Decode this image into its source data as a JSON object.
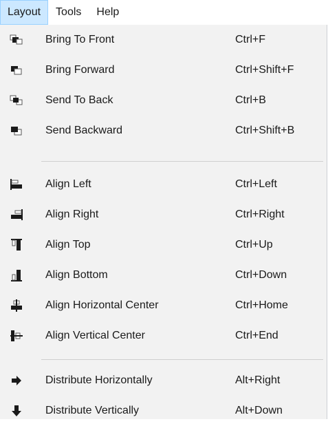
{
  "menubar": {
    "items": [
      {
        "label": "Layout"
      },
      {
        "label": "Tools"
      },
      {
        "label": "Help"
      }
    ]
  },
  "menu": {
    "groups": [
      [
        {
          "label": "Bring To Front",
          "shortcut": "Ctrl+F",
          "icon": "bring-to-front-icon"
        },
        {
          "label": "Bring Forward",
          "shortcut": "Ctrl+Shift+F",
          "icon": "bring-forward-icon"
        },
        {
          "label": "Send To Back",
          "shortcut": "Ctrl+B",
          "icon": "send-to-back-icon"
        },
        {
          "label": "Send Backward",
          "shortcut": "Ctrl+Shift+B",
          "icon": "send-backward-icon"
        }
      ],
      [
        {
          "label": "Align Left",
          "shortcut": "Ctrl+Left",
          "icon": "align-left-icon"
        },
        {
          "label": "Align Right",
          "shortcut": "Ctrl+Right",
          "icon": "align-right-icon"
        },
        {
          "label": "Align Top",
          "shortcut": "Ctrl+Up",
          "icon": "align-top-icon"
        },
        {
          "label": "Align Bottom",
          "shortcut": "Ctrl+Down",
          "icon": "align-bottom-icon"
        },
        {
          "label": "Align Horizontal Center",
          "shortcut": "Ctrl+Home",
          "icon": "align-horizontal-center-icon"
        },
        {
          "label": "Align Vertical Center",
          "shortcut": "Ctrl+End",
          "icon": "align-vertical-center-icon"
        }
      ],
      [
        {
          "label": "Distribute Horizontally",
          "shortcut": "Alt+Right",
          "icon": "arrow-right-icon"
        },
        {
          "label": "Distribute Vertically",
          "shortcut": "Alt+Down",
          "icon": "arrow-down-icon"
        }
      ]
    ]
  }
}
